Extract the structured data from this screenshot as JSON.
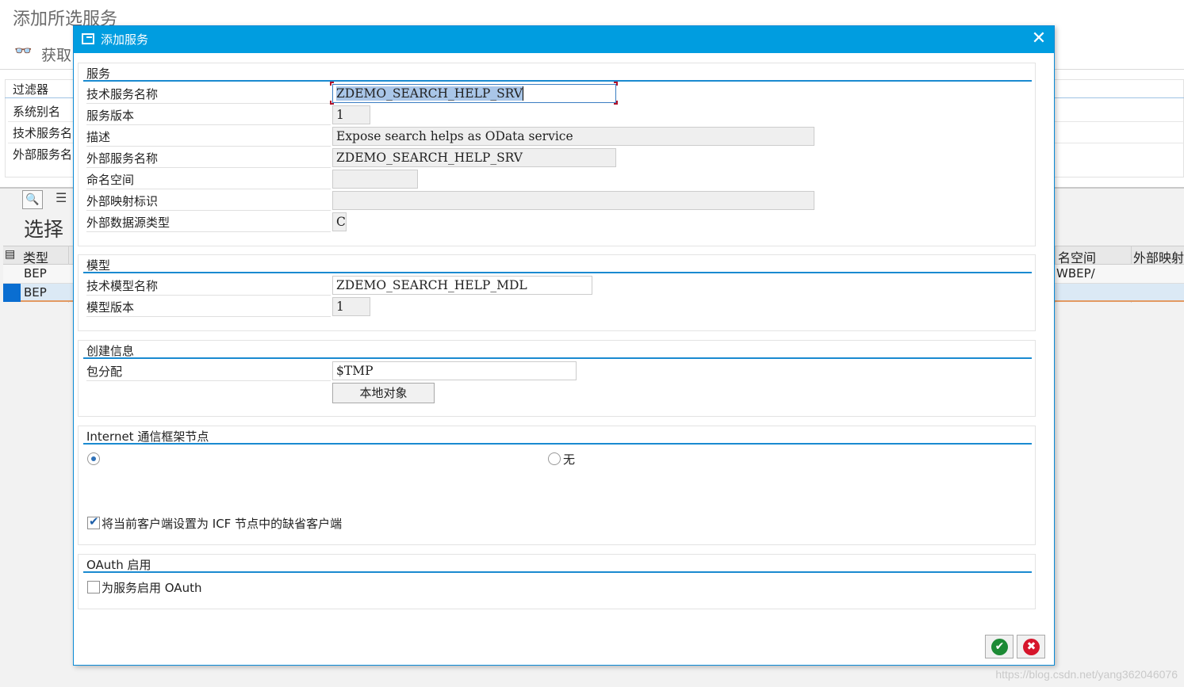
{
  "background": {
    "page_title": "添加所选服务",
    "toolbar_fetch": "获取",
    "filter": {
      "title": "过滤器",
      "rows": [
        "系统别名",
        "技术服务名",
        "外部服务名"
      ]
    },
    "section_title": "选择",
    "table": {
      "headers": [
        "类型",
        "名空间",
        "外部映射"
      ],
      "rows": [
        {
          "type": "BEP",
          "namespace": "WBEP/"
        },
        {
          "type": "BEP",
          "namespace": ""
        }
      ]
    }
  },
  "dialog": {
    "title": "添加服务",
    "service_group": {
      "title": "服务",
      "fields": [
        {
          "label": "技术服务名称",
          "value": "ZDEMO_SEARCH_HELP_SRV"
        },
        {
          "label": "服务版本",
          "value": "1"
        },
        {
          "label": "描述",
          "value": "Expose search helps as OData service"
        },
        {
          "label": "外部服务名称",
          "value": "ZDEMO_SEARCH_HELP_SRV"
        },
        {
          "label": "命名空间",
          "value": ""
        },
        {
          "label": "外部映射标识",
          "value": ""
        },
        {
          "label": "外部数据源类型",
          "value": "C"
        }
      ]
    },
    "model_group": {
      "title": "模型",
      "fields": [
        {
          "label": "技术模型名称",
          "value": "ZDEMO_SEARCH_HELP_MDL"
        },
        {
          "label": "模型版本",
          "value": "1"
        }
      ]
    },
    "creation_group": {
      "title": "创建信息",
      "package_label": "包分配",
      "package_value": "$TMP",
      "local_object_button": "本地对象"
    },
    "icf_group": {
      "title": "Internet 通信框架节点",
      "option_default_selected": true,
      "option_none_label": "无",
      "set_default_client_label": "将当前客户端设置为 ICF 节点中的缺省客户端",
      "set_default_client_checked": true
    },
    "oauth_group": {
      "title": "OAuth 启用",
      "enable_oauth_label": "为服务启用 OAuth",
      "enable_oauth_checked": false
    }
  },
  "watermark": "https://blog.csdn.net/yang362046076"
}
